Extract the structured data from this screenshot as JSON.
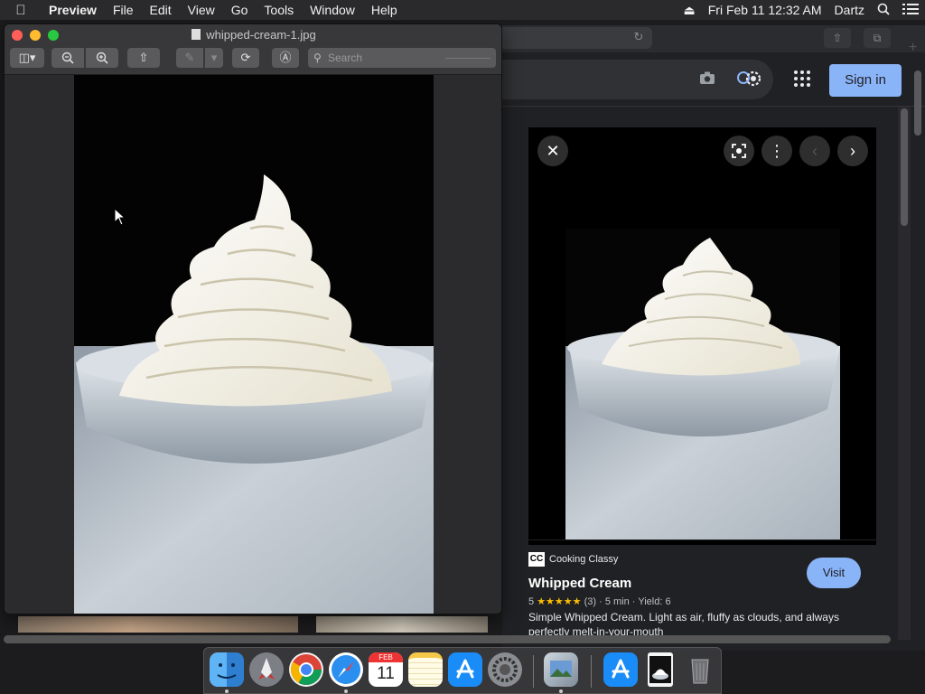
{
  "menubar": {
    "app": "Preview",
    "menus": [
      "File",
      "Edit",
      "View",
      "Go",
      "Tools",
      "Window",
      "Help"
    ],
    "clock": "Fri Feb 11  12:32 AM",
    "user": "Dartz"
  },
  "preview": {
    "title": "whipped-cream-1.jpg",
    "search_placeholder": "Search"
  },
  "browser": {
    "signin": "Sign in",
    "result": {
      "source": "Cooking Classy",
      "source_logo": "CC",
      "title": "Whipped Cream",
      "rating": "5",
      "stars": "★★★★★",
      "reviews": "(3)",
      "time": "5 min",
      "yield": "Yield: 6",
      "description": "Simple Whipped Cream. Light as air, fluffy as clouds, and always perfectly melt-in-your-mouth",
      "visit": "Visit"
    }
  },
  "dock": {
    "items": [
      "finder-icon",
      "launchpad-icon",
      "chrome-icon",
      "safari-icon",
      "calendar-icon",
      "notes-icon",
      "app-store-icon",
      "system-preferences-icon",
      "preview-icon",
      "app-store-downloads-icon",
      "image-file-icon",
      "trash-icon"
    ],
    "calendar_month": "FEB",
    "calendar_day": "11"
  },
  "colors": {
    "accent_blue": "#8ab4f8",
    "star": "#fbbc04",
    "close": "#ff5f57",
    "minimize": "#febc2e",
    "zoom": "#28c840"
  }
}
